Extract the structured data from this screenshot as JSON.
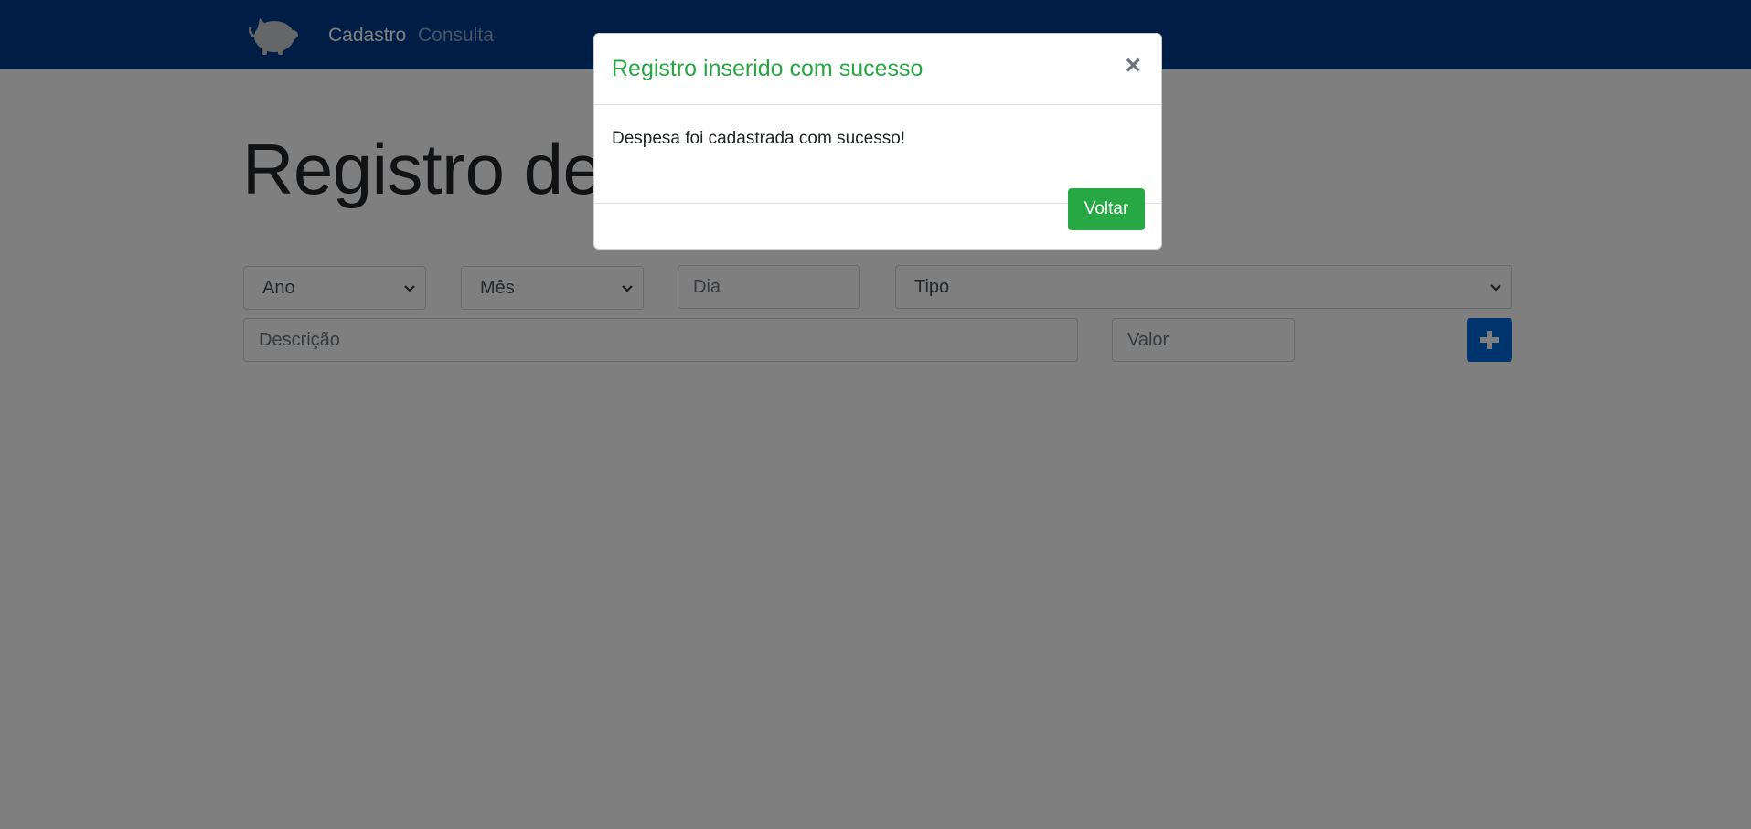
{
  "navbar": {
    "logo_icon": "piggy-bank-icon",
    "links": [
      {
        "label": "Cadastro",
        "active": true
      },
      {
        "label": "Consulta",
        "active": false
      }
    ],
    "color": "#003d8a"
  },
  "main": {
    "title": "Registro de n",
    "fields": {
      "ano": {
        "label": "Ano"
      },
      "mes": {
        "label": "Mês"
      },
      "dia": {
        "placeholder": "Dia"
      },
      "tipo": {
        "label": "Tipo"
      },
      "descricao": {
        "placeholder": "Descrição"
      },
      "valor": {
        "placeholder": "Valor"
      }
    },
    "add_button_icon": "plus-icon"
  },
  "modal": {
    "title": "Registro inserido com sucesso",
    "close_symbol": "×",
    "message": "Despesa foi cadastrada com sucesso!",
    "button_label": "Voltar",
    "accent_color": "#28a745"
  }
}
